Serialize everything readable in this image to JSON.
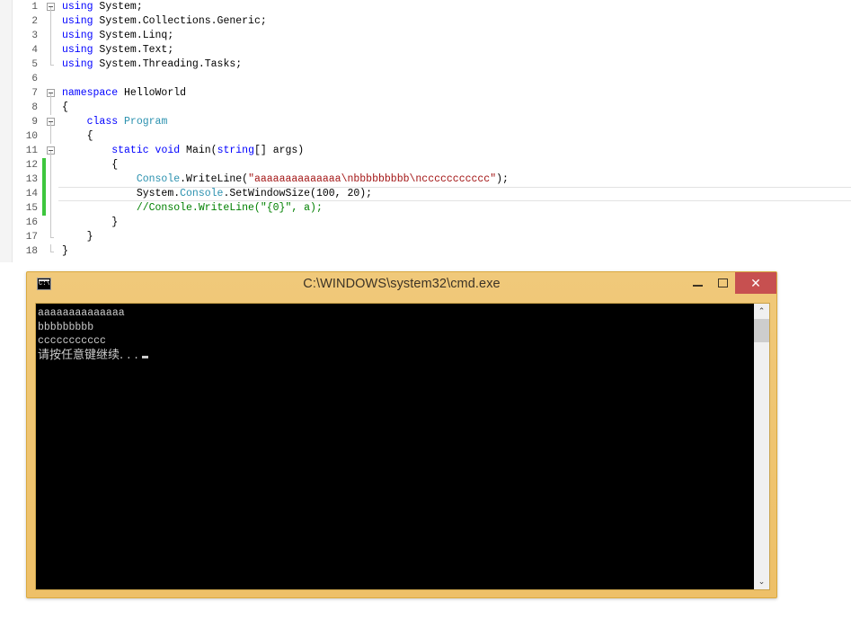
{
  "editor": {
    "lines": [
      {
        "num": "1",
        "fold": "box",
        "changed": false,
        "current": false,
        "tokens": [
          {
            "t": "kw",
            "v": "using"
          },
          {
            "t": "plain",
            "v": " System;"
          }
        ]
      },
      {
        "num": "2",
        "fold": "line",
        "changed": false,
        "current": false,
        "tokens": [
          {
            "t": "kw",
            "v": "using"
          },
          {
            "t": "plain",
            "v": " System.Collections.Generic;"
          }
        ]
      },
      {
        "num": "3",
        "fold": "line",
        "changed": false,
        "current": false,
        "tokens": [
          {
            "t": "kw",
            "v": "using"
          },
          {
            "t": "plain",
            "v": " System.Linq;"
          }
        ]
      },
      {
        "num": "4",
        "fold": "line",
        "changed": false,
        "current": false,
        "tokens": [
          {
            "t": "kw",
            "v": "using"
          },
          {
            "t": "plain",
            "v": " System.Text;"
          }
        ]
      },
      {
        "num": "5",
        "fold": "endline",
        "changed": false,
        "current": false,
        "tokens": [
          {
            "t": "kw",
            "v": "using"
          },
          {
            "t": "plain",
            "v": " System.Threading.Tasks;"
          }
        ]
      },
      {
        "num": "6",
        "fold": "none",
        "changed": false,
        "current": false,
        "tokens": [
          {
            "t": "plain",
            "v": ""
          }
        ]
      },
      {
        "num": "7",
        "fold": "box",
        "changed": false,
        "current": false,
        "tokens": [
          {
            "t": "kw",
            "v": "namespace"
          },
          {
            "t": "plain",
            "v": " HelloWorld"
          }
        ]
      },
      {
        "num": "8",
        "fold": "line",
        "changed": false,
        "current": false,
        "tokens": [
          {
            "t": "plain",
            "v": "{"
          }
        ]
      },
      {
        "num": "9",
        "fold": "box",
        "changed": false,
        "current": false,
        "tokens": [
          {
            "t": "plain",
            "v": "    "
          },
          {
            "t": "kw",
            "v": "class"
          },
          {
            "t": "plain",
            "v": " "
          },
          {
            "t": "typ",
            "v": "Program"
          }
        ]
      },
      {
        "num": "10",
        "fold": "line",
        "changed": false,
        "current": false,
        "tokens": [
          {
            "t": "plain",
            "v": "    {"
          }
        ]
      },
      {
        "num": "11",
        "fold": "box",
        "changed": false,
        "current": false,
        "tokens": [
          {
            "t": "plain",
            "v": "        "
          },
          {
            "t": "kw",
            "v": "static"
          },
          {
            "t": "plain",
            "v": " "
          },
          {
            "t": "kw",
            "v": "void"
          },
          {
            "t": "plain",
            "v": " Main("
          },
          {
            "t": "kw",
            "v": "string"
          },
          {
            "t": "plain",
            "v": "[] args)"
          }
        ]
      },
      {
        "num": "12",
        "fold": "line",
        "changed": true,
        "current": false,
        "tokens": [
          {
            "t": "plain",
            "v": "        {"
          }
        ]
      },
      {
        "num": "13",
        "fold": "line",
        "changed": true,
        "current": false,
        "tokens": [
          {
            "t": "plain",
            "v": "            "
          },
          {
            "t": "typ",
            "v": "Console"
          },
          {
            "t": "plain",
            "v": ".WriteLine("
          },
          {
            "t": "str",
            "v": "\"aaaaaaaaaaaaaa\\nbbbbbbbbb\\nccccccccccc\""
          },
          {
            "t": "plain",
            "v": ");"
          }
        ]
      },
      {
        "num": "14",
        "fold": "line",
        "changed": true,
        "current": true,
        "tokens": [
          {
            "t": "plain",
            "v": "            System."
          },
          {
            "t": "typ",
            "v": "Console"
          },
          {
            "t": "plain",
            "v": ".SetWindowSize(100, 20);"
          }
        ]
      },
      {
        "num": "15",
        "fold": "line",
        "changed": true,
        "current": false,
        "tokens": [
          {
            "t": "cmt",
            "v": "            //Console.WriteLine(\"{0}\", a);"
          }
        ]
      },
      {
        "num": "16",
        "fold": "line",
        "changed": false,
        "current": false,
        "tokens": [
          {
            "t": "plain",
            "v": "        }"
          }
        ]
      },
      {
        "num": "17",
        "fold": "endline",
        "changed": false,
        "current": false,
        "tokens": [
          {
            "t": "plain",
            "v": "    }"
          }
        ]
      },
      {
        "num": "18",
        "fold": "endline",
        "changed": false,
        "current": false,
        "tokens": [
          {
            "t": "plain",
            "v": "}"
          }
        ]
      }
    ]
  },
  "console_window": {
    "icon_name": "cmd-icon",
    "icon_text": "C:\\",
    "title": "C:\\WINDOWS\\system32\\cmd.exe",
    "minimize_label": "Minimize",
    "maximize_label": "Maximize",
    "close_label": "✕",
    "scrollbar": {
      "up_arrow": "⌃",
      "down_arrow": "⌄"
    },
    "output_lines": [
      "aaaaaaaaaaaaaa",
      "bbbbbbbbb",
      "ccccccccccc"
    ],
    "prompt_line": "请按任意键继续. . .",
    "colors": {
      "titlebar": "#efc364",
      "console_bg": "#000000",
      "console_fg": "#cccccc",
      "close_button": "#c75050"
    }
  }
}
